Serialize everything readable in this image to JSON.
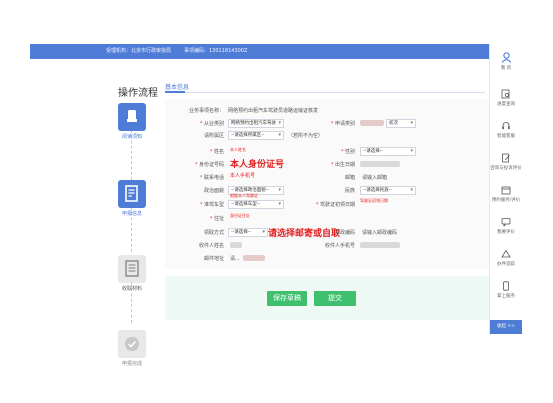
{
  "topbar": {
    "left_text": "受理机构：北京市行政审批局",
    "right_text": "事项编码：13011814300Z"
  },
  "right_sidebar": {
    "user_label": "我 的",
    "items": [
      {
        "label": "进度查询",
        "icon": "search-doc-icon"
      },
      {
        "label": "智能客服",
        "icon": "headset-icon"
      },
      {
        "label": "咨询与投诉评价",
        "icon": "edit-doc-icon"
      },
      {
        "label": "预约服务/评价",
        "icon": "calendar-icon"
      },
      {
        "label": "我要评价",
        "icon": "chat-icon"
      },
      {
        "label": "办件追踪",
        "icon": "tracking-icon"
      },
      {
        "label": "掌上服务",
        "icon": "phone-icon"
      }
    ],
    "bottom_label": "收起 >>"
  },
  "flow": {
    "title": "操作流程",
    "steps": [
      {
        "label": "阅读须知",
        "state": "active",
        "icon": "hand-icon"
      },
      {
        "label": "申报信息",
        "state": "active",
        "icon": "document-edit-icon"
      },
      {
        "label": "收取材料",
        "state": "gray",
        "icon": "list-doc-icon"
      },
      {
        "label": "申报完成",
        "state": "gray",
        "icon": "check-icon"
      }
    ]
  },
  "tab": {
    "label": "基本信息"
  },
  "form": {
    "matter_name_label": "业务事项名称：",
    "matter_name_value": "网络预约出租汽车驾驶员道路运输证核发",
    "subject_type_label": "从业类别",
    "subject_type_value": "网络预约出租汽车驾驶",
    "permit_type_label": "申请类别",
    "permit_type_value": "初次",
    "district_label": "请所属区",
    "district_value": "--请选择所属区--",
    "district_hint": "（若所不为空）",
    "name_label": "姓名",
    "name_mark": "本人姓名",
    "gender_label": "性别",
    "gender_value": "--请选择--",
    "idcard_label": "身份证号码",
    "idcard_note": "本人身份证号",
    "birth_label": "出生日期",
    "phone_label": "联系电话",
    "phone_mark": "本人手机号",
    "email_label": "邮箱",
    "email_value": "请输入邮箱",
    "political_label": "政治面貌",
    "political_value": "--请选择政治面貌--",
    "nation_label": "民族",
    "nation_value": "--请选择民族--",
    "license_label": "准驾车型",
    "license_value": "--请选择车型--",
    "license_mark": "根据本人驾驶证",
    "first_license_label": "驾驶证初领日期",
    "first_license_mark": "驾驶证初领日期",
    "address_label": "住址",
    "address_mark": "身份证住址",
    "receive_label": "领取方式",
    "receive_value": "--请选择--",
    "receive_note": "请选择邮寄或自取",
    "postcode_label": "邮政编码",
    "postcode_value": "请输入邮政编码",
    "receiver_label": "收件人姓名",
    "receiver_phone_label": "收件人手机号",
    "mail_address_label": "邮件地址",
    "mail_address_value": "请..."
  },
  "buttons": {
    "save_draft": "保存草稿",
    "submit": "提交"
  },
  "colors": {
    "primary": "#4f7cd6",
    "accent_green": "#3ec06e",
    "warning_red": "#e02020"
  }
}
